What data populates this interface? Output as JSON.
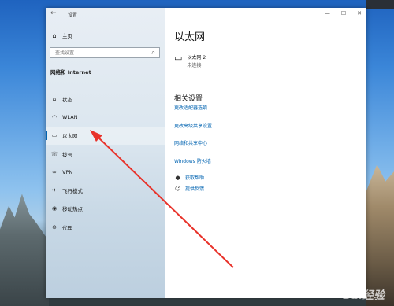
{
  "window": {
    "title": "设置",
    "controls": [
      "—",
      "☐",
      "✕"
    ]
  },
  "sidebar": {
    "home_label": "主页",
    "search_placeholder": "查找设置",
    "section": "网络和 Internet",
    "items": [
      {
        "icon": "status-icon",
        "label": "状态"
      },
      {
        "icon": "wifi-icon",
        "label": "WLAN"
      },
      {
        "icon": "ethernet-icon",
        "label": "以太网",
        "active": true
      },
      {
        "icon": "dialup-icon",
        "label": "拨号"
      },
      {
        "icon": "vpn-icon",
        "label": "VPN"
      },
      {
        "icon": "airplane-icon",
        "label": "飞行模式"
      },
      {
        "icon": "hotspot-icon",
        "label": "移动热点"
      },
      {
        "icon": "proxy-icon",
        "label": "代理"
      }
    ]
  },
  "main": {
    "title": "以太网",
    "adapter": {
      "name": "以太网 2",
      "status": "未连接"
    },
    "related_title": "相关设置",
    "links": [
      "更改适配器选项",
      "更改高级共享设置",
      "网络和共享中心",
      "Windows 防火墙"
    ],
    "help": [
      "获取帮助",
      "提供反馈"
    ]
  },
  "watermark": "Bai经验",
  "colors": {
    "accent": "#0063b1",
    "arrow": "#e8322a"
  }
}
